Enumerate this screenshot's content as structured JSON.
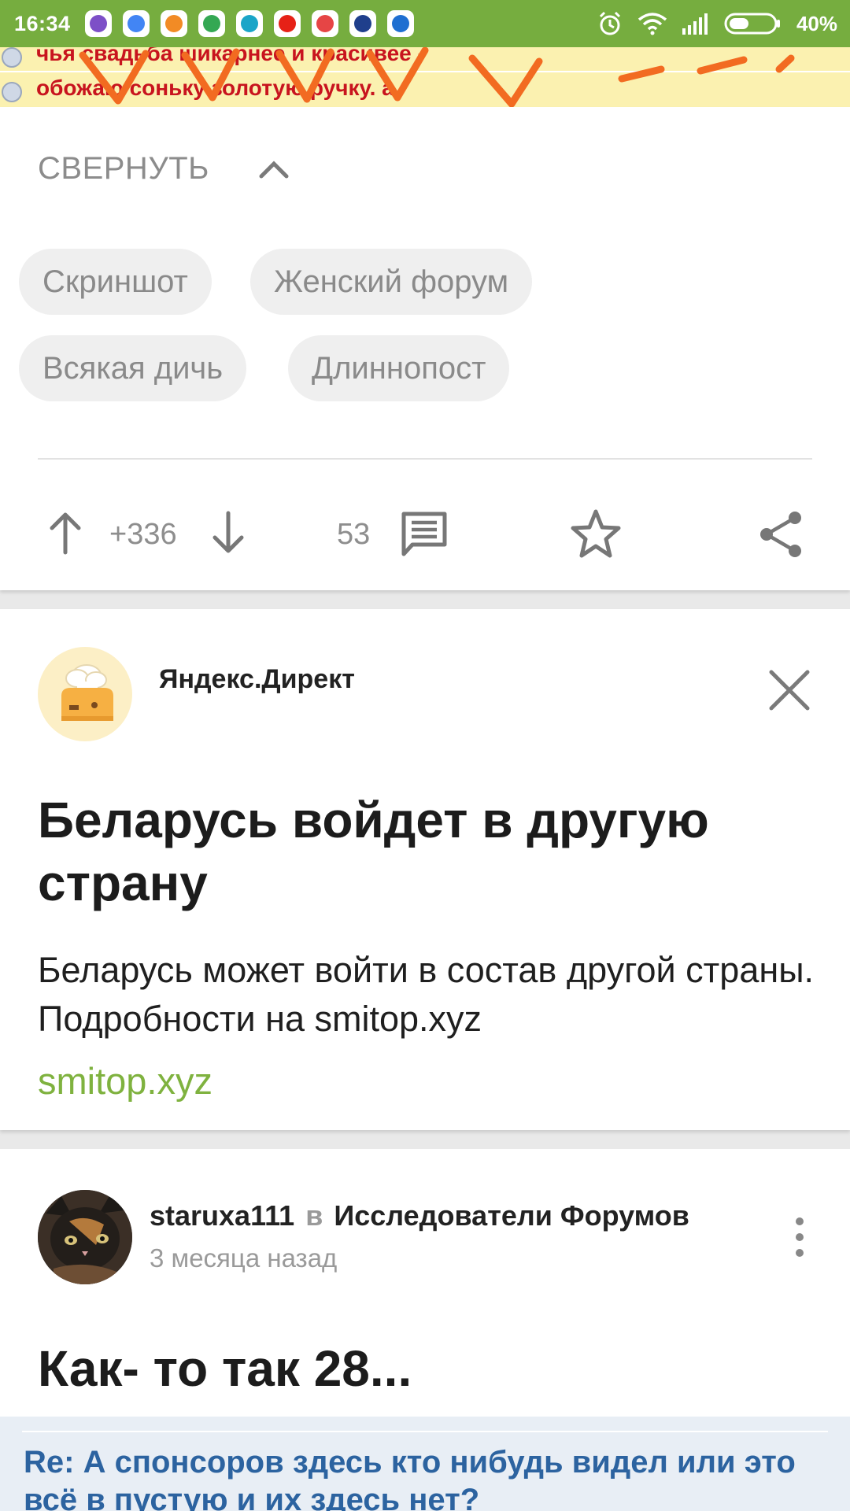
{
  "status_bar": {
    "time": "16:34",
    "battery_percent": "40%",
    "app_icons": [
      "viber-icon",
      "chrome-icon",
      "pikabu-icon",
      "maps-icon",
      "app-icon",
      "youtube-icon",
      "yandex-icon",
      "weather-channel-icon",
      "voice-recorder-icon"
    ],
    "icon_colors": [
      "#7d4fc7",
      "#4285f4",
      "#f28b25",
      "#34a853",
      "#1aa5c8",
      "#e62117",
      "#e64545",
      "#1f3f8c",
      "#1f6fd1"
    ]
  },
  "embedded_image": {
    "lines": [
      "чья свадьба шикарнее и красивее -",
      "обожаю соньку золотую ручку. а"
    ]
  },
  "post": {
    "collapse_label": "СВЕРНУТЬ",
    "tags": [
      "Скриншот",
      "Женский форум",
      "Всякая дичь",
      "Длиннопост"
    ],
    "rating": "+336",
    "comments_count": "53"
  },
  "ad": {
    "source": "Яндекс.Директ",
    "title": "Беларусь войдет в другую страну",
    "description": "Беларусь может войти в состав другой страны. Подробности на smitop.xyz",
    "link": "smitop.xyz"
  },
  "next_post": {
    "author": "staruxa111",
    "in_word": "в",
    "community": "Исследователи Форумов",
    "time": "3 месяца назад",
    "title": "Как- то так 28...",
    "image_caption": "Re: А спонсоров здесь кто нибудь видел или это всё в пустую и их здесь нет?"
  },
  "colors": {
    "status_bar": "#76ad3f",
    "accent_link": "#7fb23f",
    "tag_bg": "#efefef"
  }
}
